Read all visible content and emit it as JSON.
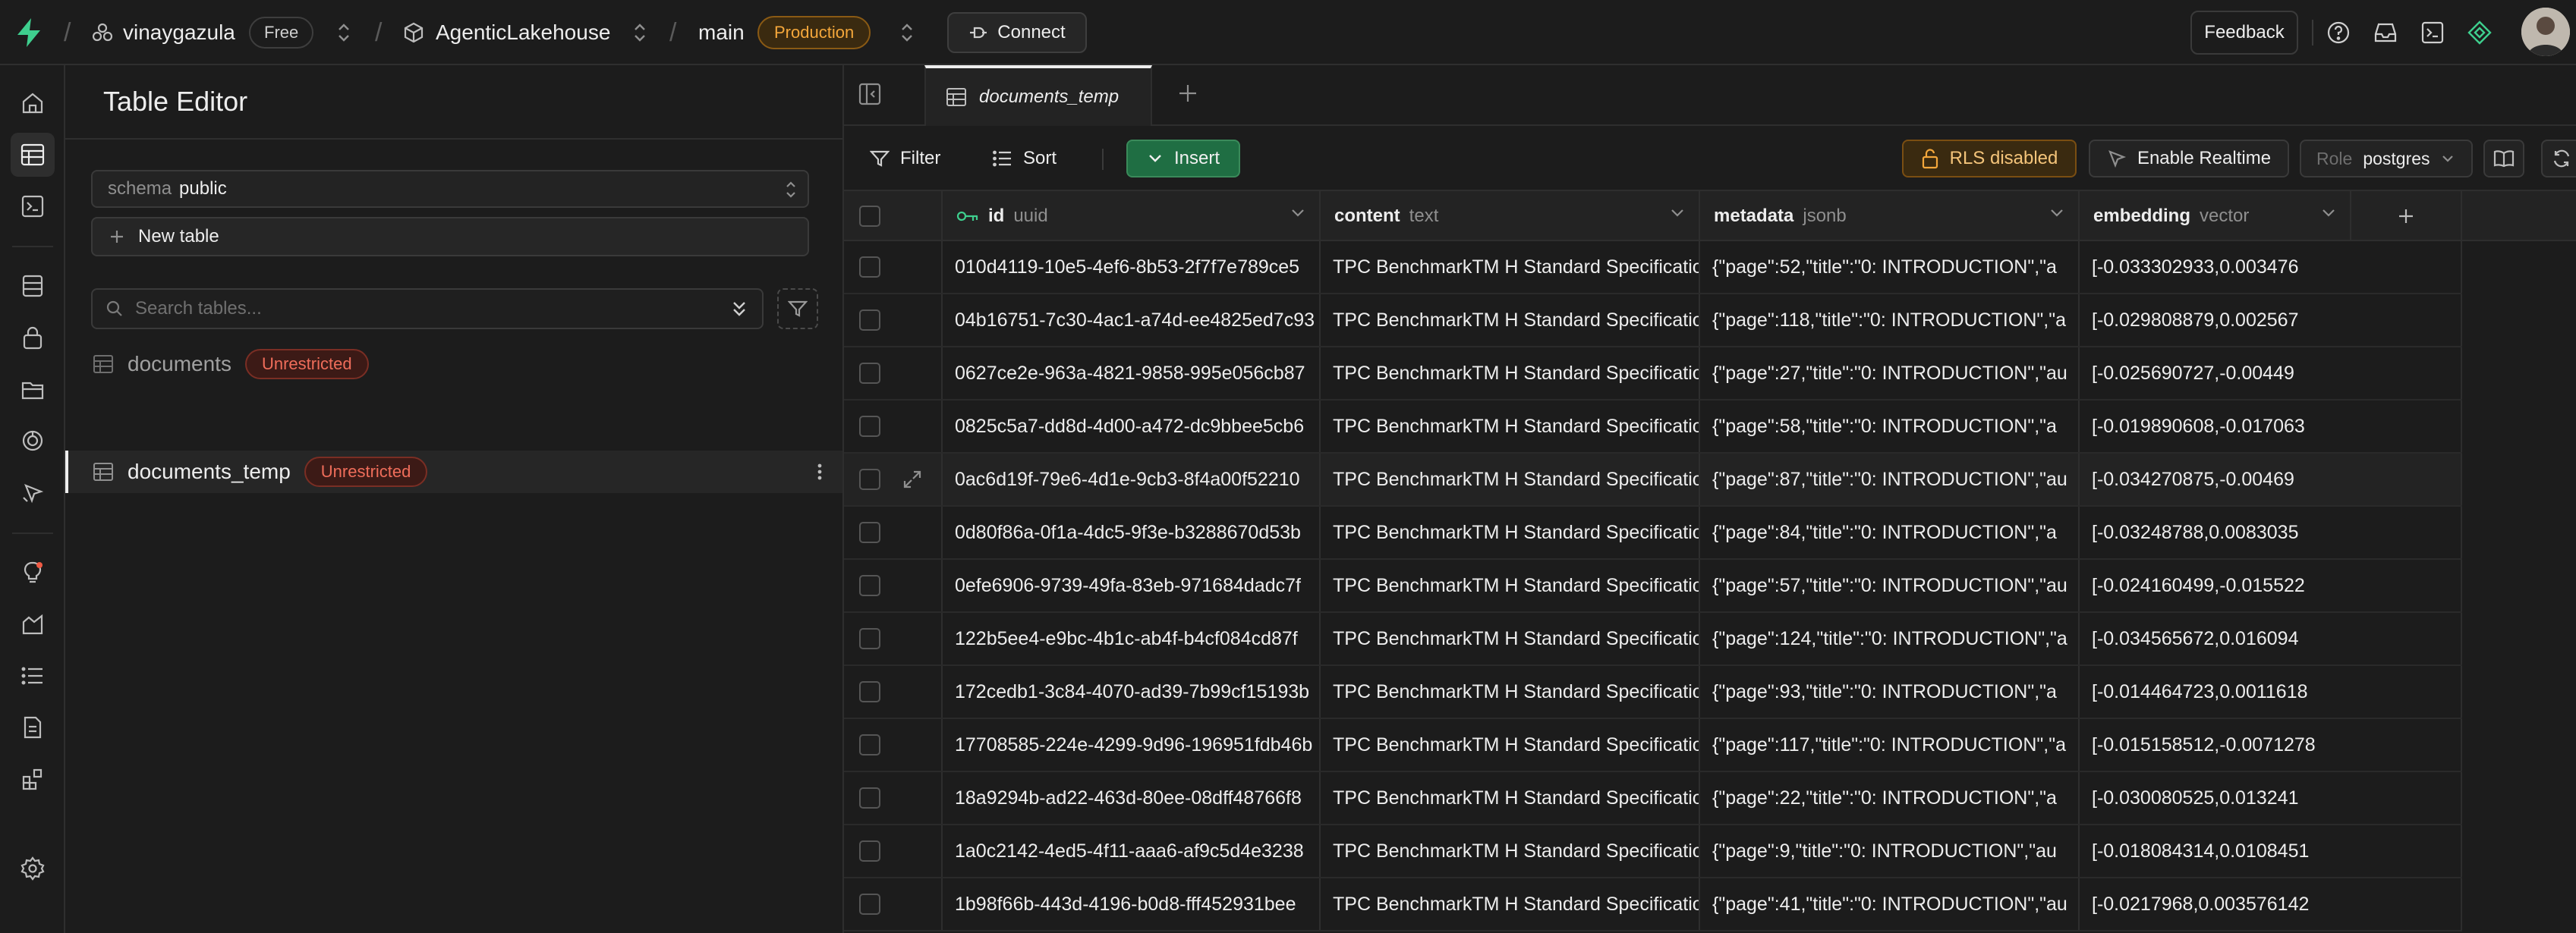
{
  "topbar": {
    "org": "vinaygazula",
    "plan": "Free",
    "project": "AgenticLakehouse",
    "branch": "main",
    "env": "Production",
    "connect": "Connect",
    "feedback": "Feedback"
  },
  "sidebar": {
    "title": "Table Editor",
    "schema_label": "schema",
    "schema_value": "public",
    "new_table": "New table",
    "search_placeholder": "Search tables...",
    "tables": [
      {
        "name": "documents",
        "badge": "Unrestricted"
      },
      {
        "name": "documents_temp",
        "badge": "Unrestricted"
      }
    ]
  },
  "tab": {
    "label": "documents_temp"
  },
  "toolbar": {
    "filter": "Filter",
    "sort": "Sort",
    "insert": "Insert",
    "rls": "RLS disabled",
    "realtime": "Enable Realtime",
    "role_label": "Role",
    "role_value": "postgres"
  },
  "columns": [
    {
      "name": "id",
      "type": "uuid"
    },
    {
      "name": "content",
      "type": "text"
    },
    {
      "name": "metadata",
      "type": "jsonb"
    },
    {
      "name": "embedding",
      "type": "vector"
    }
  ],
  "rows": [
    {
      "id": "010d4119-10e5-4ef6-8b53-2f7f7e789ce5",
      "content": "TPC BenchmarkTM H Standard Specification",
      "metadata": "{\"page\":52,\"title\":\"0: INTRODUCTION\",\"a",
      "embedding": "[-0.033302933,0.003476"
    },
    {
      "id": "04b16751-7c30-4ac1-a74d-ee4825ed7c93",
      "content": "TPC BenchmarkTM H Standard Specification",
      "metadata": "{\"page\":118,\"title\":\"0: INTRODUCTION\",\"a",
      "embedding": "[-0.029808879,0.002567"
    },
    {
      "id": "0627ce2e-963a-4821-9858-995e056cb87",
      "content": "TPC BenchmarkTM H Standard Specification",
      "metadata": "{\"page\":27,\"title\":\"0: INTRODUCTION\",\"au",
      "embedding": "[-0.025690727,-0.00449"
    },
    {
      "id": "0825c5a7-dd8d-4d00-a472-dc9bbee5cb6",
      "content": "TPC BenchmarkTM H Standard Specification",
      "metadata": "{\"page\":58,\"title\":\"0: INTRODUCTION\",\"a",
      "embedding": "[-0.019890608,-0.017063"
    },
    {
      "id": "0ac6d19f-79e6-4d1e-9cb3-8f4a00f52210",
      "content": "TPC BenchmarkTM H Standard Specification",
      "metadata": "{\"page\":87,\"title\":\"0: INTRODUCTION\",\"au",
      "embedding": "[-0.034270875,-0.00469"
    },
    {
      "id": "0d80f86a-0f1a-4dc5-9f3e-b3288670d53b",
      "content": "TPC BenchmarkTM H Standard Specification",
      "metadata": "{\"page\":84,\"title\":\"0: INTRODUCTION\",\"a",
      "embedding": "[-0.03248788,0.0083035"
    },
    {
      "id": "0efe6906-9739-49fa-83eb-971684dadc7f",
      "content": "TPC BenchmarkTM H Standard Specification",
      "metadata": "{\"page\":57,\"title\":\"0: INTRODUCTION\",\"au",
      "embedding": "[-0.024160499,-0.015522"
    },
    {
      "id": "122b5ee4-e9bc-4b1c-ab4f-b4cf084cd87f",
      "content": "TPC BenchmarkTM H Standard Specification",
      "metadata": "{\"page\":124,\"title\":\"0: INTRODUCTION\",\"a",
      "embedding": "[-0.034565672,0.016094"
    },
    {
      "id": "172cedb1-3c84-4070-ad39-7b99cf15193b",
      "content": "TPC BenchmarkTM H Standard Specification",
      "metadata": "{\"page\":93,\"title\":\"0: INTRODUCTION\",\"a",
      "embedding": "[-0.014464723,0.0011618"
    },
    {
      "id": "17708585-224e-4299-9d96-196951fdb46b",
      "content": "TPC BenchmarkTM H Standard Specification",
      "metadata": "{\"page\":117,\"title\":\"0: INTRODUCTION\",\"a",
      "embedding": "[-0.015158512,-0.0071278"
    },
    {
      "id": "18a9294b-ad22-463d-80ee-08dff48766f8",
      "content": "TPC BenchmarkTM H Standard Specification",
      "metadata": "{\"page\":22,\"title\":\"0: INTRODUCTION\",\"a",
      "embedding": "[-0.030080525,0.013241"
    },
    {
      "id": "1a0c2142-4ed5-4f11-aaa6-af9c5d4e3238",
      "content": "TPC BenchmarkTM H Standard Specification",
      "metadata": "{\"page\":9,\"title\":\"0: INTRODUCTION\",\"au",
      "embedding": "[-0.018084314,0.0108451"
    },
    {
      "id": "1b98f66b-443d-4196-b0d8-fff452931bee",
      "content": "TPC BenchmarkTM H Standard Specification",
      "metadata": "{\"page\":41,\"title\":\"0: INTRODUCTION\",\"au",
      "embedding": "[-0.0217968,0.003576142"
    }
  ]
}
